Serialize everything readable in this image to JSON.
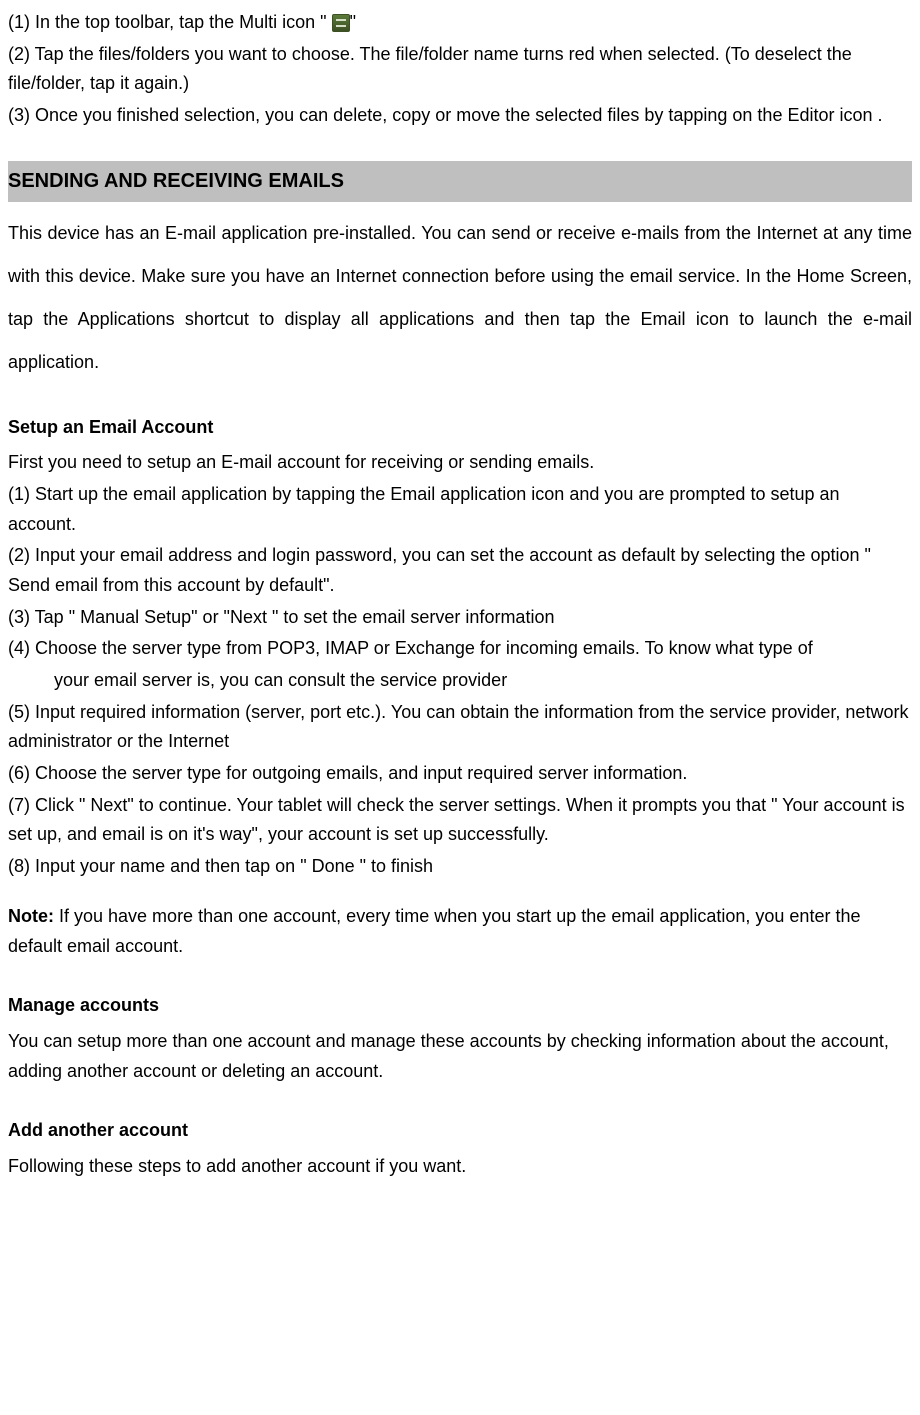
{
  "top_steps": {
    "s1_prefix": "(1)    In the top toolbar, tap the Multi icon \"  ",
    "s1_suffix": "\"",
    "s2": "(2)    Tap the files/folders you want to choose. The file/folder name turns red when selected. (To deselect the file/folder, tap it again.)",
    "s3": "(3)    Once you finished selection, you can delete, copy or move the selected files by tapping on the Editor icon      ."
  },
  "section_header": "SENDING AND RECEIVING EMAILS",
  "intro": "This device has an E-mail application pre-installed. You can send or receive e-mails from the Internet at any time with this device. Make sure you have an Internet connection before using the email service. In the Home Screen, tap the Applications shortcut to display all applications and then tap the Email icon to launch the e-mail application.",
  "setup_heading": "Setup an Email Account",
  "setup_intro": "First you need to setup an E-mail account for receiving or sending emails.",
  "setup_steps": {
    "s1": "(1)    Start up the email application by tapping the Email application icon and you are prompted to setup an account.",
    "s2": "(2)    Input your email address and login password, you can set the account as default by selecting the option \" Send email from this account by default\".",
    "s3": "(3)    Tap \" Manual Setup\"    or    \"Next \" to set the email server information",
    "s4a": "(4)    Choose the server type from POP3, IMAP or Exchange for incoming emails. To know what type of",
    "s4b": "your email server is, you can consult the service provider",
    "s5": "(5)    Input required information (server, port etc.). You can obtain the information from the service provider, network administrator or the Internet",
    "s6": "(6)    Choose the server type for outgoing emails, and input required server information.",
    "s7": "(7)    Click \" Next\" to continue. Your tablet will check the server settings. When it prompts you that \" Your account is set up, and email is on it's way\", your account is set up successfully.",
    "s8": "(8)    Input your name and then tap on \" Done \" to finish"
  },
  "note_label": "Note:",
  "note_text": " If you have more than one account, every time when you start up the email application, you enter the default email account.",
  "manage_heading": "Manage accounts",
  "manage_text": "You can setup more than one account and manage these accounts by checking information about the account, adding another account or deleting an account.",
  "add_heading": "Add another account",
  "add_text": "Following these steps to add another account if you want."
}
